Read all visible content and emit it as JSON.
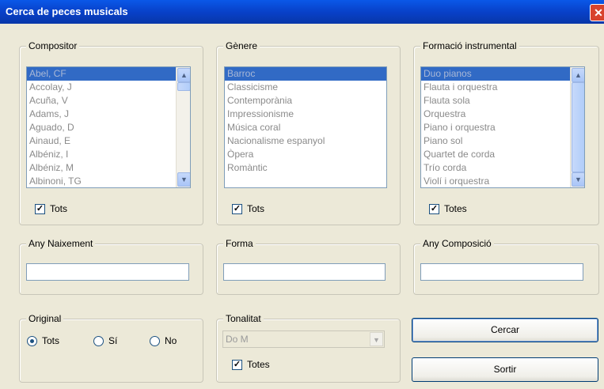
{
  "window": {
    "title": "Cerca de peces musicals"
  },
  "compositor": {
    "label": "Compositor",
    "items": [
      "Abel, CF",
      "Accolay, J",
      "Acuña, V",
      "Adams, J",
      "Aguado, D",
      "Ainaud, E",
      "Albéniz, I",
      "Albéniz, M",
      "Albinoni, TG"
    ],
    "selected": "Abel, CF",
    "all_label": "Tots",
    "all_checked": true
  },
  "genere": {
    "label": "Gènere",
    "items": [
      "Barroc",
      "Classicisme",
      "Contemporània",
      "Impressionisme",
      "Música coral",
      "Nacionalisme espanyol",
      "Òpera",
      "Romàntic"
    ],
    "selected": "Barroc",
    "all_label": "Tots",
    "all_checked": true
  },
  "formacio": {
    "label": "Formació instrumental",
    "items": [
      "Duo pianos",
      "Flauta i orquestra",
      "Flauta sola",
      "Orquestra",
      "Piano i orquestra",
      "Piano sol",
      "Quartet de corda",
      "Trío corda",
      "Violí i orquestra"
    ],
    "selected": "Duo pianos",
    "all_label": "Totes",
    "all_checked": true
  },
  "any_naixement": {
    "label": "Any Naixement",
    "value": ""
  },
  "forma": {
    "label": "Forma",
    "value": ""
  },
  "any_composicio": {
    "label": "Any Composició",
    "value": ""
  },
  "original": {
    "label": "Original",
    "options": [
      "Tots",
      "Sí",
      "No"
    ],
    "selected": "Tots"
  },
  "tonalitat": {
    "label": "Tonalitat",
    "value": "Do M",
    "all_label": "Totes",
    "all_checked": true
  },
  "buttons": {
    "search": "Cercar",
    "exit": "Sortir"
  },
  "icons": {
    "close": "close-icon",
    "scroll_up": "arrow-up-icon",
    "scroll_down": "arrow-down-icon",
    "dropdown": "chevron-down-icon"
  },
  "colors": {
    "titlebar": "#0841c9",
    "selection": "#316ac5",
    "dialog": "#ece9d8"
  }
}
